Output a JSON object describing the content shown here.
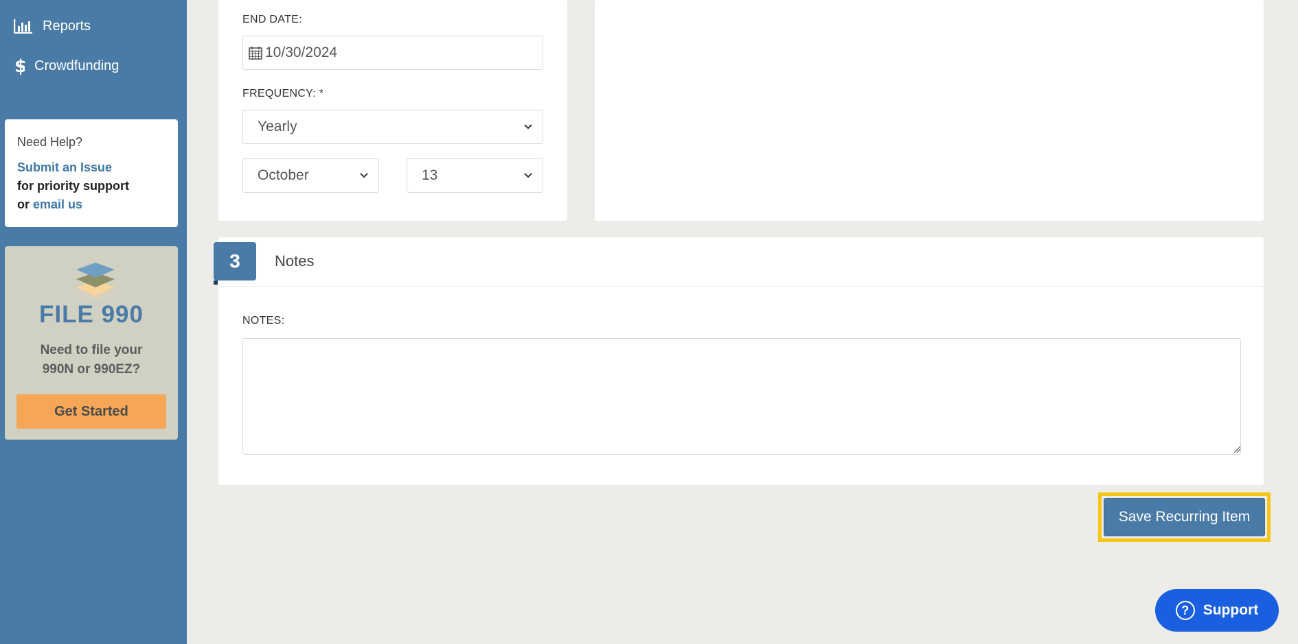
{
  "sidebar": {
    "nav": [
      {
        "label": "Reports",
        "icon": "bar-chart-icon"
      },
      {
        "label": "Crowdfunding",
        "icon": "dollar-icon"
      }
    ],
    "help": {
      "title": "Need Help?",
      "submit_link": "Submit an Issue",
      "priority_text": "for priority support",
      "or_text": "or",
      "email_link": "email us"
    },
    "file990": {
      "title": "FILE 990",
      "description": "Need to file your 990N or 990EZ?",
      "button": "Get Started",
      "icon": "stacked-layers-icon"
    }
  },
  "schedule": {
    "end_date_label": "END DATE:",
    "end_date_value": "10/30/2024",
    "frequency_label": "FREQUENCY: *",
    "frequency_value": "Yearly",
    "month_value": "October",
    "day_value": "13"
  },
  "notes": {
    "step_number": "3",
    "title": "Notes",
    "label": "NOTES:",
    "value": ""
  },
  "actions": {
    "save_label": "Save Recurring Item",
    "support_label": "Support"
  },
  "colors": {
    "sidebar": "#4a7ba6",
    "accent": "#4a7ba6",
    "highlight": "#f5c518",
    "get_started": "#f5a656",
    "support": "#1a5fe0"
  }
}
